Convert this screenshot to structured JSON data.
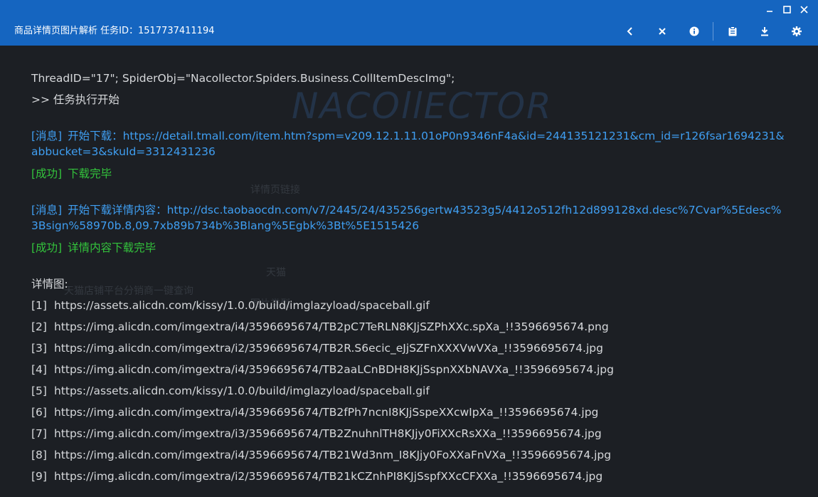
{
  "window": {
    "title": "商品详情页图片解析 任务ID：1517737411194",
    "controls": [
      "minimize-icon",
      "maximize-icon",
      "close-icon"
    ]
  },
  "toolbar": {
    "icons": [
      "chevron-left-icon",
      "close-icon",
      "info-icon",
      "clipboard-icon",
      "download-icon",
      "settings-icon"
    ]
  },
  "watermark": "NACOllECTOR",
  "log": {
    "header_line": "ThreadID=\"17\"; SpiderObj=\"Nacollector.Spiders.Business.CollItemDescImg\";",
    "start_line": ">> 任务执行开始",
    "msg1": {
      "tag": "[消息]",
      "text": "开始下载：https://detail.tmall.com/item.htm?spm=v209.12.1.11.01oP0n9346nF4a&id=244135121231&cm_id=r126fsar1694231&abbucket=3&skuId=3312431236"
    },
    "ok1": {
      "tag": "[成功]",
      "text": "下载完毕"
    },
    "msg2": {
      "tag": "[消息]",
      "text": "开始下载详情内容：http://dsc.taobaocdn.com/v7/2445/24/435256gertw43523g5/4412o512fh12d899128xd.desc%7Cvar%5Edesc%3Bsign%58970b.8,09.7xb89b734b%3Blang%5Egbk%3Bt%5E1515426"
    },
    "ok2": {
      "tag": "[成功]",
      "text": "详情内容下载完毕"
    },
    "detail_label": "详情图:",
    "images": [
      {
        "idx": "[1]",
        "url": "https://assets.alicdn.com/kissy/1.0.0/build/imglazyload/spaceball.gif"
      },
      {
        "idx": "[2]",
        "url": "https://img.alicdn.com/imgextra/i4/3596695674/TB2pC7TeRLN8KJjSZPhXXc.spXa_!!3596695674.png"
      },
      {
        "idx": "[3]",
        "url": "https://img.alicdn.com/imgextra/i2/3596695674/TB2R.S6ecic_eJjSZFnXXXVwVXa_!!3596695674.jpg"
      },
      {
        "idx": "[4]",
        "url": "https://img.alicdn.com/imgextra/i4/3596695674/TB2aaLCnBDH8KJjSspnXXbNAVXa_!!3596695674.jpg"
      },
      {
        "idx": "[5]",
        "url": "https://assets.alicdn.com/kissy/1.0.0/build/imglazyload/spaceball.gif"
      },
      {
        "idx": "[6]",
        "url": "https://img.alicdn.com/imgextra/i4/3596695674/TB2fPh7ncnI8KJjSspeXXcwIpXa_!!3596695674.jpg"
      },
      {
        "idx": "[7]",
        "url": "https://img.alicdn.com/imgextra/i3/3596695674/TB2ZnuhnlTH8KJjy0FiXXcRsXXa_!!3596695674.jpg"
      },
      {
        "idx": "[8]",
        "url": "https://img.alicdn.com/imgextra/i4/3596695674/TB21Wd3nm_I8KJjy0FoXXaFnVXa_!!3596695674.jpg"
      },
      {
        "idx": "[9]",
        "url": "https://img.alicdn.com/imgextra/i2/3596695674/TB21kCZnhPI8KJjSspfXXcCFXXa_!!3596695674.jpg"
      }
    ]
  },
  "background_ghost": {
    "label1": "详情页链接",
    "label2": "图片类型",
    "dropdown_value": "天猫",
    "note": "天猫店铺平台分销商一键查询"
  },
  "colors": {
    "titlebar": "#1565c0",
    "background": "#1c1f24",
    "info": "#3f9ef1",
    "success": "#33c43c",
    "text": "#d6d8db"
  }
}
